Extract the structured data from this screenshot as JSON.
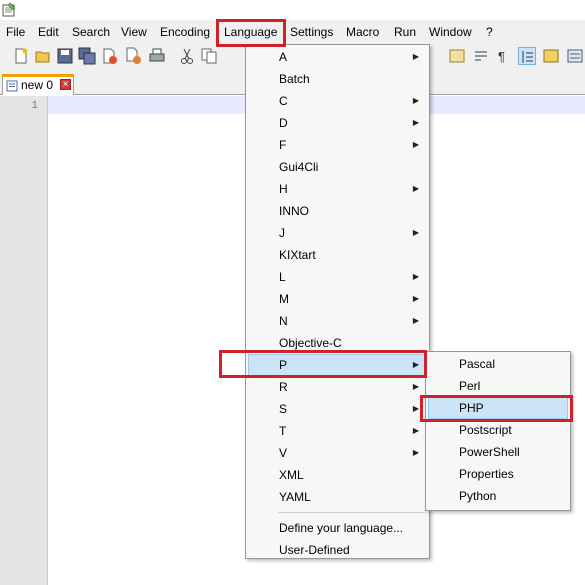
{
  "menubar": {
    "items": [
      "File",
      "Edit",
      "Search",
      "View",
      "Encoding",
      "Language",
      "Settings",
      "Macro",
      "Run",
      "Window",
      "?"
    ]
  },
  "tab": {
    "label": "new  0",
    "close_icon": "close-icon"
  },
  "editor": {
    "line_number": "1"
  },
  "language_menu": {
    "items": [
      {
        "label": "A",
        "submenu": true
      },
      {
        "label": "Batch",
        "submenu": false
      },
      {
        "label": "C",
        "submenu": true
      },
      {
        "label": "D",
        "submenu": true
      },
      {
        "label": "F",
        "submenu": true
      },
      {
        "label": "Gui4Cli",
        "submenu": false
      },
      {
        "label": "H",
        "submenu": true
      },
      {
        "label": "INNO",
        "submenu": false
      },
      {
        "label": "J",
        "submenu": true
      },
      {
        "label": "KIXtart",
        "submenu": false
      },
      {
        "label": "L",
        "submenu": true
      },
      {
        "label": "M",
        "submenu": true
      },
      {
        "label": "N",
        "submenu": true
      },
      {
        "label": "Objective-C",
        "submenu": false
      },
      {
        "label": "P",
        "submenu": true
      },
      {
        "label": "R",
        "submenu": true
      },
      {
        "label": "S",
        "submenu": true
      },
      {
        "label": "T",
        "submenu": true
      },
      {
        "label": "V",
        "submenu": true
      },
      {
        "label": "XML",
        "submenu": false
      },
      {
        "label": "YAML",
        "submenu": false
      }
    ],
    "footer": [
      "Define your language...",
      "User-Defined"
    ],
    "highlighted": "P"
  },
  "p_submenu": {
    "items": [
      "Pascal",
      "Perl",
      "PHP",
      "Postscript",
      "PowerShell",
      "Properties",
      "Python"
    ],
    "highlighted": "PHP"
  },
  "colors": {
    "highlight_box": "#d0202a",
    "menu_hover": "#cce4f7",
    "tab_accent": "#f0a000"
  }
}
